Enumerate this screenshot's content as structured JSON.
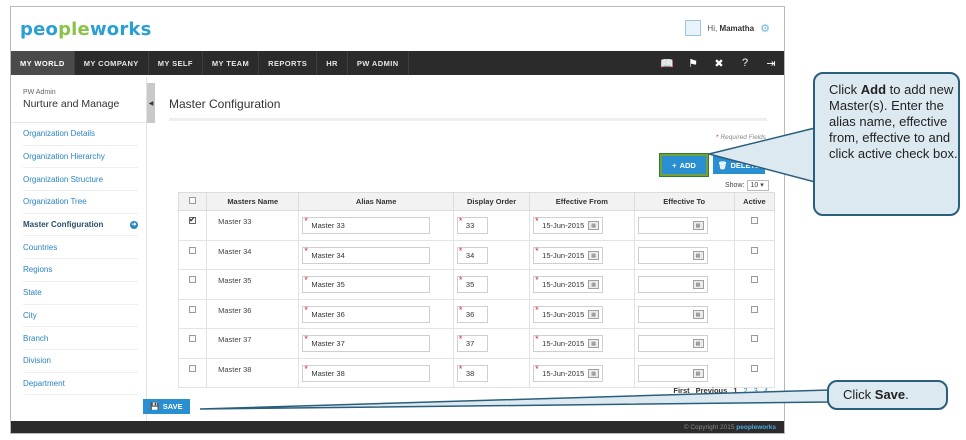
{
  "brand": {
    "logo_part1": "peo",
    "logo_accent": "ple",
    "logo_part2": "works"
  },
  "user": {
    "greeting": "Hi,",
    "name": "Mamatha"
  },
  "nav": {
    "items": [
      "MY WORLD",
      "MY COMPANY",
      "MY SELF",
      "MY TEAM",
      "REPORTS",
      "HR",
      "PW ADMIN"
    ],
    "active": "MY WORLD",
    "icons": [
      "book-icon",
      "pin-icon",
      "tools-icon",
      "help-icon",
      "logout-icon"
    ]
  },
  "sidebar": {
    "subtitle": "PW Admin",
    "title": "Nurture and Manage",
    "items": [
      {
        "label": "Organization Details"
      },
      {
        "label": "Organization Hierarchy"
      },
      {
        "label": "Organization Structure"
      },
      {
        "label": "Organization Tree"
      },
      {
        "label": "Master Configuration"
      },
      {
        "label": "Countries"
      },
      {
        "label": "Regions"
      },
      {
        "label": "State"
      },
      {
        "label": "City"
      },
      {
        "label": "Branch"
      },
      {
        "label": "Division"
      },
      {
        "label": "Department"
      }
    ],
    "active_index": 4
  },
  "main": {
    "title": "Master Configuration",
    "required_note": "Required Fields",
    "add_label": "ADD",
    "delete_label": "DELETE",
    "show_label": "Show:",
    "show_value": "10",
    "columns": [
      "",
      "Masters Name",
      "Alias Name",
      "Display Order",
      "Effective From",
      "Effective To",
      "Active"
    ],
    "rows": [
      {
        "checked": true,
        "name": "Master 33",
        "alias": "Master 33",
        "order": "33",
        "from": "15-Jun-2015",
        "to": ""
      },
      {
        "checked": false,
        "name": "Master 34",
        "alias": "Master 34",
        "order": "34",
        "from": "15-Jun-2015",
        "to": ""
      },
      {
        "checked": false,
        "name": "Master 35",
        "alias": "Master 35",
        "order": "35",
        "from": "15-Jun-2015",
        "to": ""
      },
      {
        "checked": false,
        "name": "Master 36",
        "alias": "Master 36",
        "order": "36",
        "from": "15-Jun-2015",
        "to": ""
      },
      {
        "checked": false,
        "name": "Master 37",
        "alias": "Master 37",
        "order": "37",
        "from": "15-Jun-2015",
        "to": ""
      },
      {
        "checked": false,
        "name": "Master 38",
        "alias": "Master 38",
        "order": "38",
        "from": "15-Jun-2015",
        "to": ""
      }
    ],
    "pager": {
      "first": "First",
      "previous": "Previous",
      "pages": [
        "1",
        "2",
        "3",
        "4"
      ]
    },
    "save_label": "SAVE"
  },
  "footer": {
    "copyright": "© Copyright 2015",
    "brand": "peopleworks"
  },
  "callouts": {
    "add": {
      "pre": "Click ",
      "bold": "Add",
      "post": " to add new Master(s). Enter the alias name, effective from, effective to and click active check box."
    },
    "save": {
      "pre": "Click ",
      "bold": "Save",
      "post": "."
    }
  },
  "colors": {
    "accent": "#2a8fd0",
    "nav": "#2b2b2b",
    "callout_bg": "#dce9f0",
    "callout_border": "#2a5f7c",
    "highlight": "#73a03c"
  }
}
